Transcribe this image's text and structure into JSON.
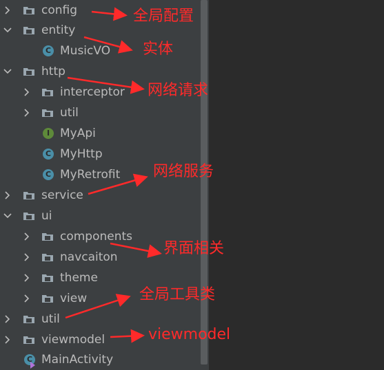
{
  "tree": {
    "items": [
      {
        "label": "config",
        "kind": "folder",
        "state": "collapsed"
      },
      {
        "label": "entity",
        "kind": "folder",
        "state": "expanded"
      },
      {
        "label": "MusicVO",
        "kind": "class",
        "icon_letter": "C"
      },
      {
        "label": "http",
        "kind": "folder",
        "state": "expanded"
      },
      {
        "label": "interceptor",
        "kind": "folder",
        "state": "collapsed"
      },
      {
        "label": "util",
        "kind": "folder",
        "state": "collapsed"
      },
      {
        "label": "MyApi",
        "kind": "interface",
        "icon_letter": "I"
      },
      {
        "label": "MyHttp",
        "kind": "class",
        "icon_letter": "C"
      },
      {
        "label": "MyRetrofit",
        "kind": "class",
        "icon_letter": "C"
      },
      {
        "label": "service",
        "kind": "folder",
        "state": "collapsed"
      },
      {
        "label": "ui",
        "kind": "folder",
        "state": "expanded"
      },
      {
        "label": "components",
        "kind": "folder",
        "state": "collapsed"
      },
      {
        "label": "navcaiton",
        "kind": "folder",
        "state": "collapsed"
      },
      {
        "label": "theme",
        "kind": "folder",
        "state": "collapsed"
      },
      {
        "label": "view",
        "kind": "folder",
        "state": "collapsed"
      },
      {
        "label": "util",
        "kind": "folder",
        "state": "collapsed"
      },
      {
        "label": "viewmodel",
        "kind": "folder",
        "state": "collapsed"
      },
      {
        "label": "MainActivity",
        "kind": "activity",
        "icon_letter": "C"
      }
    ]
  },
  "annotations": [
    {
      "text": "全局配置"
    },
    {
      "text": "实体"
    },
    {
      "text": "网络请求"
    },
    {
      "text": "网络服务"
    },
    {
      "text": "界面相关"
    },
    {
      "text": "全局工具类"
    },
    {
      "text": "viewmodel"
    }
  ],
  "colors": {
    "panel_bg": "#3c3f41",
    "editor_bg": "#2b2b2b",
    "text": "#bbbbbb",
    "annotation": "#ff2a2a",
    "class_icon": "#4a8fa8",
    "interface_icon": "#5e8a3a",
    "folder_icon": "#9aa7b0"
  }
}
